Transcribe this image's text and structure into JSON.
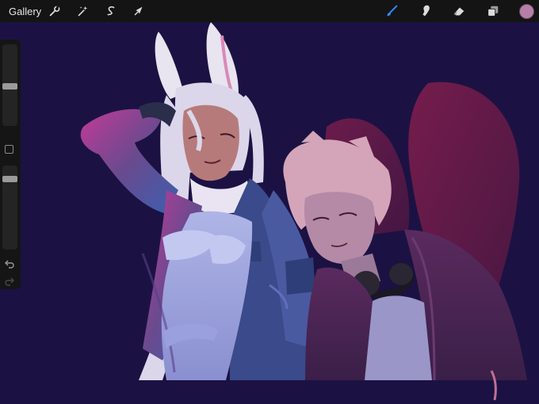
{
  "topbar": {
    "gallery_label": "Gallery",
    "left_tools": [
      {
        "name": "actions",
        "icon": "wrench-icon"
      },
      {
        "name": "adjustments",
        "icon": "magic-wand-icon"
      },
      {
        "name": "selection",
        "icon": "selection-s-icon"
      },
      {
        "name": "transform",
        "icon": "cursor-arrow-icon"
      }
    ],
    "right_tools": [
      {
        "name": "brush",
        "icon": "brush-icon",
        "active": true
      },
      {
        "name": "smudge",
        "icon": "smudge-finger-icon"
      },
      {
        "name": "eraser",
        "icon": "eraser-icon"
      },
      {
        "name": "layers",
        "icon": "layers-icon"
      }
    ],
    "active_color": "#b77fa8",
    "active_tool_color": "#2e8cff"
  },
  "sidebar": {
    "brush_size_level": 0.48,
    "opacity_level": 0.13,
    "icons": [
      "modify-square-icon",
      "undo-icon",
      "redo-icon"
    ]
  },
  "canvas": {
    "background_color": "#1b1243",
    "artwork": "digital-painting"
  }
}
